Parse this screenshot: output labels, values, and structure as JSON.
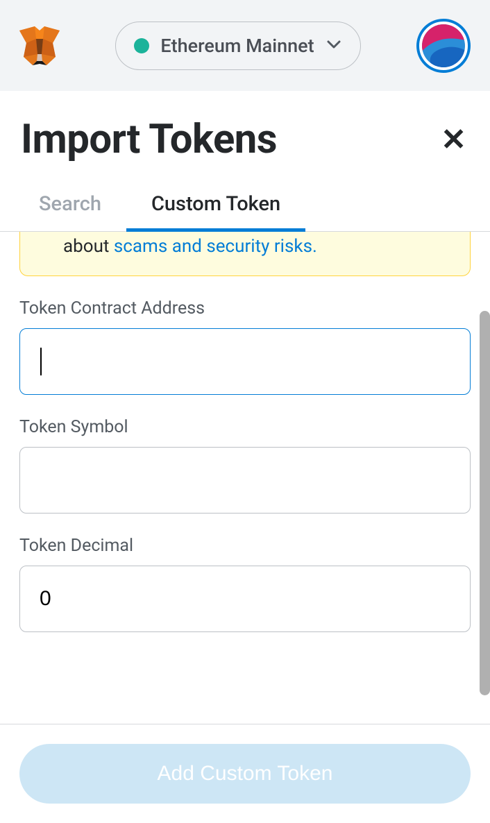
{
  "header": {
    "network_label": "Ethereum Mainnet"
  },
  "page": {
    "title": "Import Tokens"
  },
  "tabs": {
    "search": "Search",
    "custom": "Custom Token"
  },
  "warning": {
    "visible_text_1": "fake versions of existing tokens. Learn more about ",
    "link_text": "scams and security risks."
  },
  "fields": {
    "address": {
      "label": "Token Contract Address",
      "value": ""
    },
    "symbol": {
      "label": "Token Symbol",
      "value": ""
    },
    "decimal": {
      "label": "Token Decimal",
      "value": "0"
    }
  },
  "footer": {
    "add_button": "Add Custom Token"
  }
}
